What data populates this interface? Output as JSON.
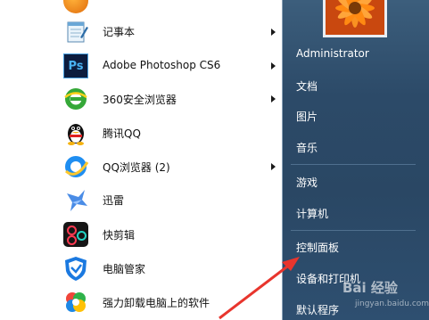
{
  "start_menu": {
    "programs": [
      {
        "label": "",
        "has_submenu": false
      },
      {
        "label": "记事本",
        "has_submenu": true
      },
      {
        "label": "Adobe Photoshop CS6",
        "has_submenu": true
      },
      {
        "label": "360安全浏览器",
        "has_submenu": true
      },
      {
        "label": "腾讯QQ",
        "has_submenu": false
      },
      {
        "label": "QQ浏览器 (2)",
        "has_submenu": true
      },
      {
        "label": "迅雷",
        "has_submenu": false
      },
      {
        "label": "快剪辑",
        "has_submenu": false
      },
      {
        "label": "电脑管家",
        "has_submenu": false
      },
      {
        "label": "强力卸载电脑上的软件",
        "has_submenu": false
      }
    ],
    "right_pane": {
      "user_name": "Administrator",
      "items": [
        "文档",
        "图片",
        "音乐",
        "游戏",
        "计算机",
        "控制面板",
        "设备和打印机",
        "默认程序"
      ]
    }
  },
  "watermark": {
    "text": "Bai 经验",
    "sub": "jingyan.baidu.com"
  },
  "colors": {
    "right_pane": "#2c4a68",
    "arrow": "#e8352d"
  },
  "icons": [
    "notepad-icon",
    "photoshop-icon",
    "browser-360-icon",
    "qq-penguin-icon",
    "qq-browser-icon",
    "xunlei-icon",
    "kuaijianji-icon",
    "pc-manager-icon",
    "uninstaller-icon"
  ]
}
